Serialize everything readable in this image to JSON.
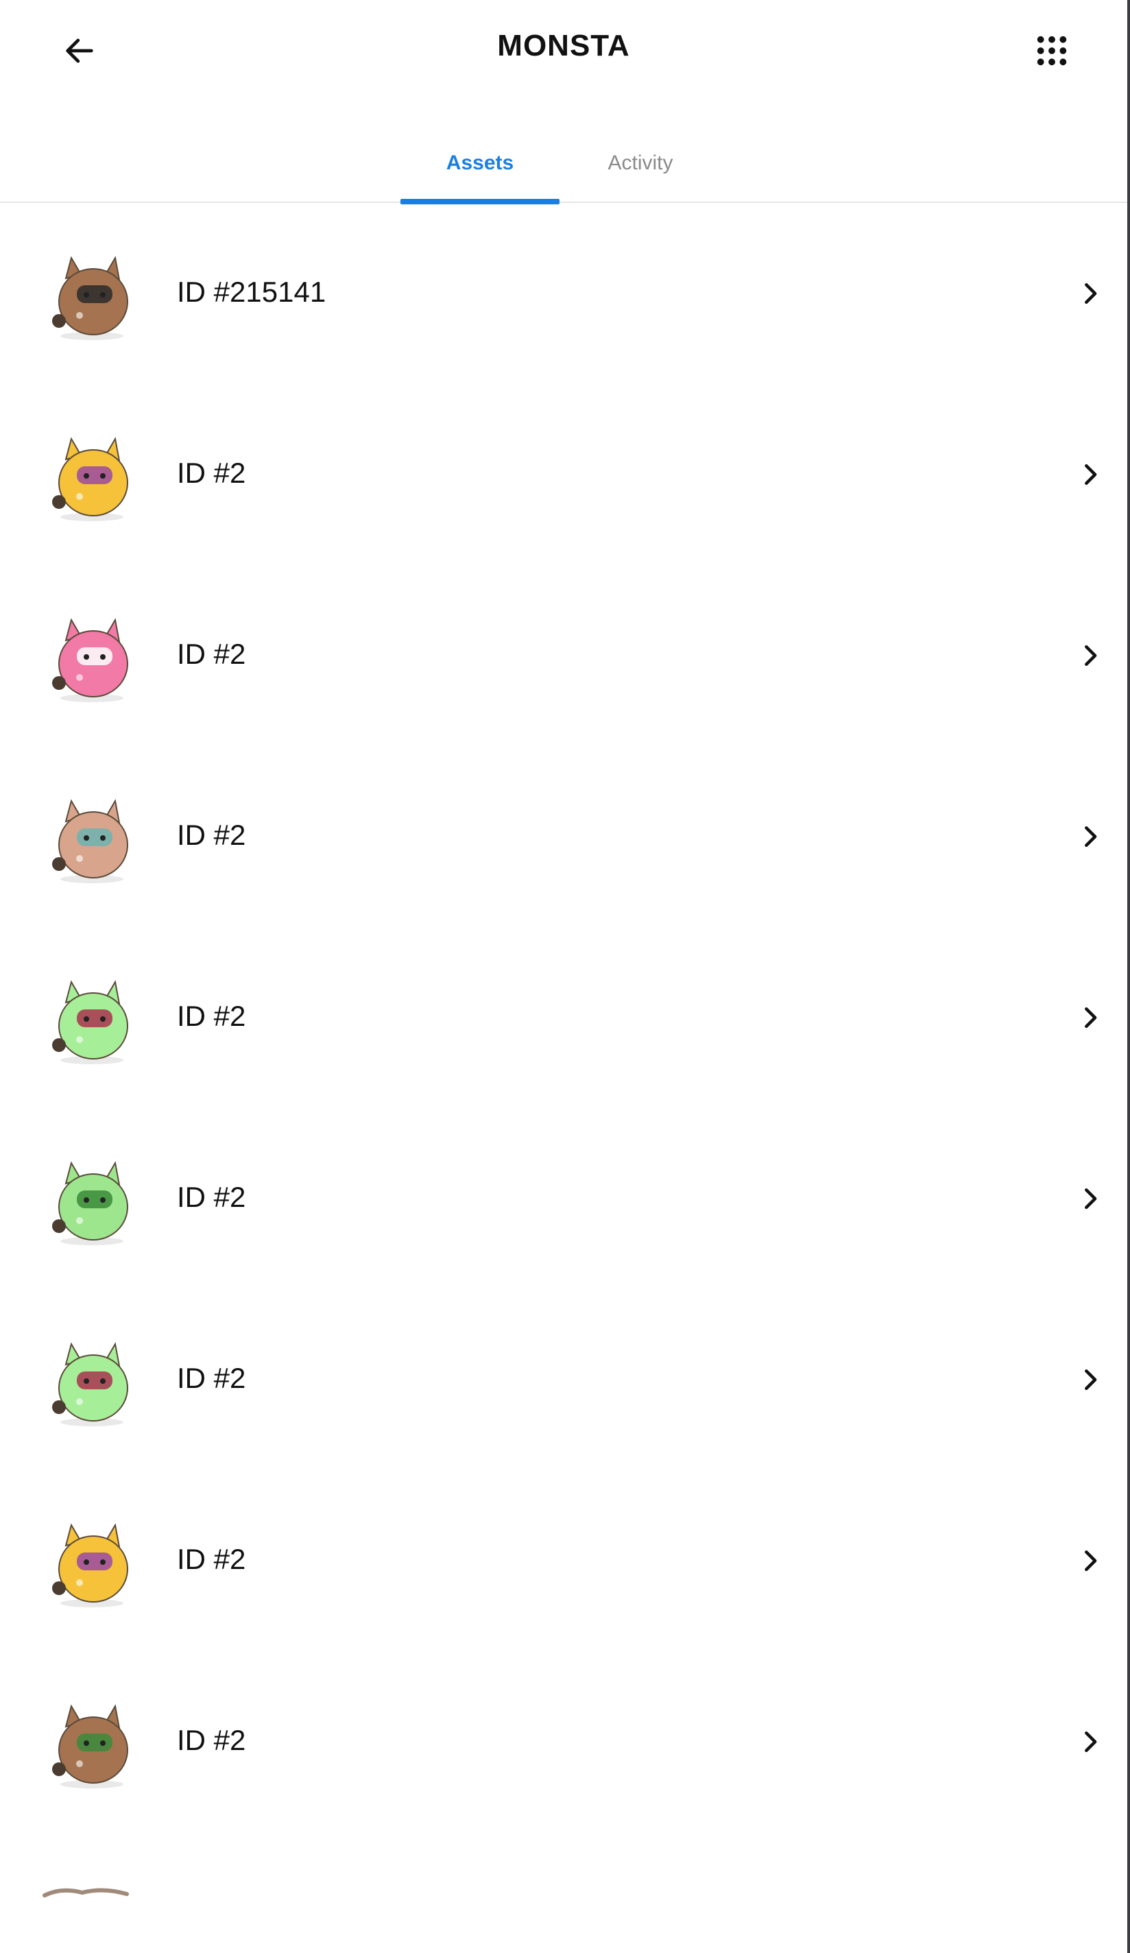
{
  "header": {
    "title": "MONSTA",
    "back_icon": "arrow-left-icon",
    "apps_icon": "grid-menu-icon"
  },
  "tabs": [
    {
      "label": "Assets",
      "active": true
    },
    {
      "label": "Activity",
      "active": false
    }
  ],
  "colors": {
    "accent": "#1a7fe0",
    "inactive_tab": "#8a8a8a",
    "text": "#111111"
  },
  "assets": [
    {
      "label": "ID #215141",
      "color": "#a5734f",
      "accent": "#2a2a2a",
      "icon": "brown-masked-creature-icon"
    },
    {
      "label": "ID #2",
      "color": "#f5c23a",
      "accent": "#9b4aa3",
      "icon": "yellow-creature-icon"
    },
    {
      "label": "ID #2",
      "color": "#f27aa6",
      "accent": "#ffffff",
      "icon": "pink-creature-icon"
    },
    {
      "label": "ID #2",
      "color": "#d8a58c",
      "accent": "#6fb3b0",
      "icon": "tan-creature-icon"
    },
    {
      "label": "ID #2",
      "color": "#a6ee98",
      "accent": "#a8324e",
      "icon": "green-creature-icon"
    },
    {
      "label": "ID #2",
      "color": "#9ee68e",
      "accent": "#3a8a3a",
      "icon": "leafy-green-creature-icon"
    },
    {
      "label": "ID #2",
      "color": "#a6ee98",
      "accent": "#a8324e",
      "icon": "green-creature-icon"
    },
    {
      "label": "ID #2",
      "color": "#f5c23a",
      "accent": "#9b4aa3",
      "icon": "yellow-creature-icon"
    },
    {
      "label": "ID #2",
      "color": "#a5734f",
      "accent": "#3a8a3a",
      "icon": "brown-leafy-creature-icon"
    }
  ]
}
